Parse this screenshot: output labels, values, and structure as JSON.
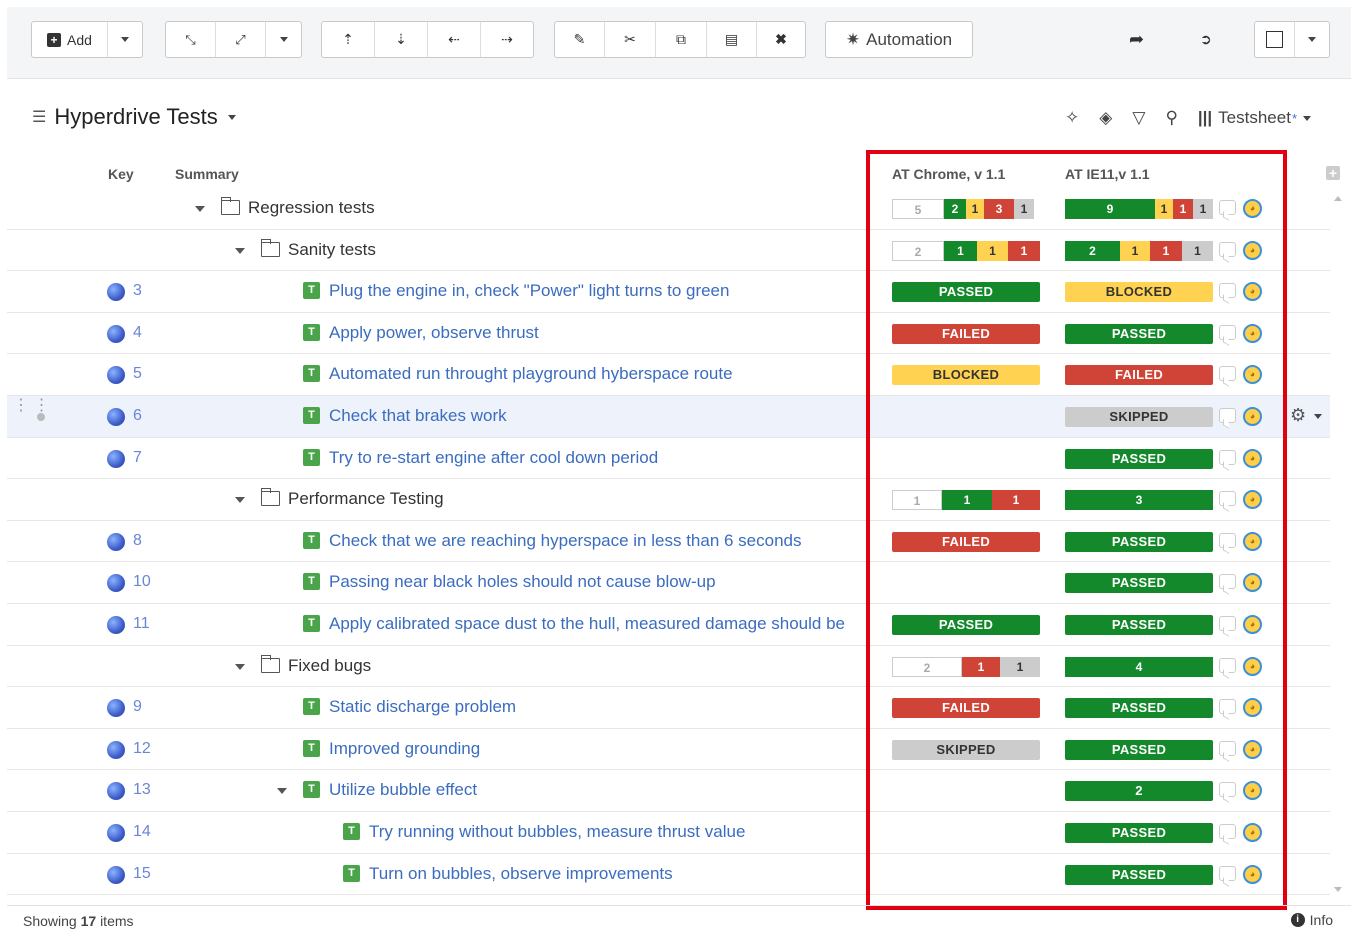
{
  "toolbar": {
    "add_label": "Add",
    "automation_label": "Automation"
  },
  "view": {
    "title": "Hyperdrive Tests",
    "testsheet_label": "Testsheet",
    "testsheet_star": "*"
  },
  "columns": {
    "key": "Key",
    "summary": "Summary",
    "chrome": "AT Chrome, v 1.1",
    "ie": "AT IE11,v 1.1"
  },
  "rows": [
    {
      "type": "folder",
      "depth": 0,
      "label": "Regression tests",
      "chrome": [
        {
          "c": "w",
          "v": "5",
          "w": 52
        },
        {
          "c": "g",
          "v": "2",
          "w": 22
        },
        {
          "c": "y",
          "v": "1",
          "w": 18
        },
        {
          "c": "r",
          "v": "3",
          "w": 30
        },
        {
          "c": "s",
          "v": "1",
          "w": 20
        }
      ],
      "ie": [
        {
          "c": "g",
          "v": "9",
          "w": 90
        },
        {
          "c": "y",
          "v": "1",
          "w": 18
        },
        {
          "c": "r",
          "v": "1",
          "w": 20
        },
        {
          "c": "s",
          "v": "1",
          "w": 20
        }
      ]
    },
    {
      "type": "folder",
      "depth": 1,
      "label": "Sanity tests",
      "chrome": [
        {
          "c": "w",
          "v": "2",
          "w": 52
        },
        {
          "c": "g",
          "v": "1",
          "w": 33
        },
        {
          "c": "y",
          "v": "1",
          "w": 31
        },
        {
          "c": "r",
          "v": "1",
          "w": 32
        }
      ],
      "ie": [
        {
          "c": "g",
          "v": "2",
          "w": 55
        },
        {
          "c": "y",
          "v": "1",
          "w": 30
        },
        {
          "c": "r",
          "v": "1",
          "w": 32
        },
        {
          "c": "s",
          "v": "1",
          "w": 31
        }
      ]
    },
    {
      "type": "test",
      "depth": 2,
      "key": "3",
      "label": "Plug the engine in, check \"Power\" light turns to green",
      "chrome": "PASSED",
      "ie": "BLOCKED"
    },
    {
      "type": "test",
      "depth": 2,
      "key": "4",
      "label": "Apply power, observe thrust",
      "chrome": "FAILED",
      "ie": "PASSED"
    },
    {
      "type": "test",
      "depth": 2,
      "key": "5",
      "label": "Automated run throught playground hyberspace route",
      "chrome": "BLOCKED",
      "ie": "FAILED"
    },
    {
      "type": "test",
      "depth": 2,
      "key": "6",
      "label": "Check that brakes work",
      "chrome": "",
      "ie": "SKIPPED",
      "selected": true
    },
    {
      "type": "test",
      "depth": 2,
      "key": "7",
      "label": "Try to re-start engine after cool down period",
      "chrome": "",
      "ie": "PASSED"
    },
    {
      "type": "folder",
      "depth": 1,
      "label": "Performance Testing",
      "chrome": [
        {
          "c": "w",
          "v": "1",
          "w": 50
        },
        {
          "c": "g",
          "v": "1",
          "w": 50
        },
        {
          "c": "r",
          "v": "1",
          "w": 48
        }
      ],
      "ie": [
        {
          "c": "g",
          "v": "3",
          "w": 148
        }
      ]
    },
    {
      "type": "test",
      "depth": 2,
      "key": "8",
      "label": "Check that we are reaching hyperspace in less than 6 seconds",
      "chrome": "FAILED",
      "ie": "PASSED"
    },
    {
      "type": "test",
      "depth": 2,
      "key": "10",
      "label": "Passing near black holes should not cause blow-up",
      "chrome": "",
      "ie": "PASSED"
    },
    {
      "type": "test",
      "depth": 2,
      "key": "11",
      "label": "Apply calibrated space dust to the hull, measured damage should be",
      "chrome": "PASSED",
      "ie": "PASSED"
    },
    {
      "type": "folder",
      "depth": 1,
      "label": "Fixed bugs",
      "chrome": [
        {
          "c": "w",
          "v": "2",
          "w": 70
        },
        {
          "c": "r",
          "v": "1",
          "w": 38
        },
        {
          "c": "s",
          "v": "1",
          "w": 40
        }
      ],
      "ie": [
        {
          "c": "g",
          "v": "4",
          "w": 148
        }
      ]
    },
    {
      "type": "test",
      "depth": 2,
      "key": "9",
      "label": "Static discharge problem",
      "chrome": "FAILED",
      "ie": "PASSED"
    },
    {
      "type": "test",
      "depth": 2,
      "key": "12",
      "label": "Improved grounding",
      "chrome": "SKIPPED",
      "ie": "PASSED"
    },
    {
      "type": "test",
      "depth": 2,
      "key": "13",
      "label": "Utilize bubble effect",
      "chrome": "",
      "ie_summary": "2",
      "expanded": true
    },
    {
      "type": "test",
      "depth": 3,
      "key": "14",
      "label": "Try running without bubbles, measure thrust value",
      "chrome": "",
      "ie": "PASSED"
    },
    {
      "type": "test",
      "depth": 3,
      "key": "15",
      "label": "Turn on bubbles, observe improvements",
      "chrome": "",
      "ie": "PASSED"
    }
  ],
  "footer": {
    "showing_prefix": "Showing",
    "count": "17",
    "showing_suffix": "items",
    "info_label": "Info"
  }
}
